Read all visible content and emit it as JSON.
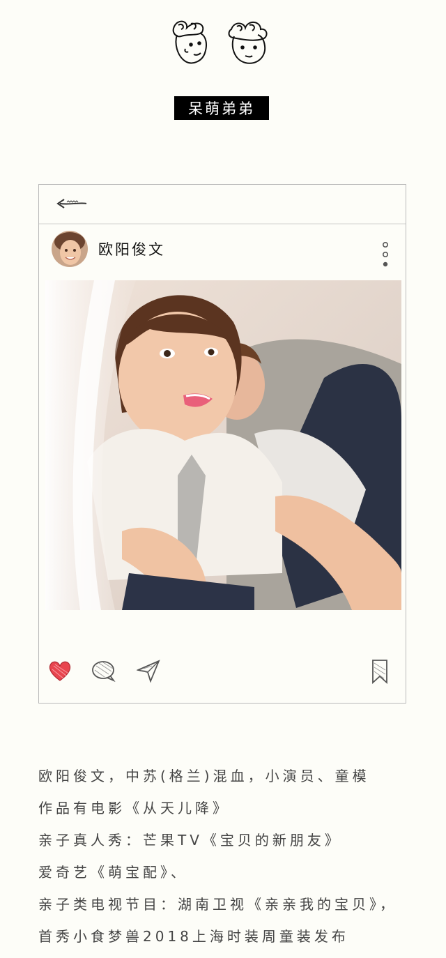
{
  "header": {
    "title": "呆萌弟弟"
  },
  "post": {
    "username": "欧阳俊文",
    "actions": {
      "like_icon": "heart-icon",
      "comment_icon": "comment-bubble-icon",
      "share_icon": "paper-plane-icon",
      "save_icon": "bookmark-icon"
    },
    "colors": {
      "heart": "#e8454f",
      "border": "#b9b9b9"
    }
  },
  "bio": {
    "lines": [
      "欧阳俊文，中苏(格兰)混血，小演员、童模",
      "作品有电影《从天儿降》",
      "亲子真人秀：芒果TV《宝贝的新朋友》",
      "爱奇艺《萌宝配》、",
      "亲子类电视节目：湖南卫视《亲亲我的宝贝》，",
      "首秀小食梦兽2018上海时装周童装发布"
    ]
  }
}
